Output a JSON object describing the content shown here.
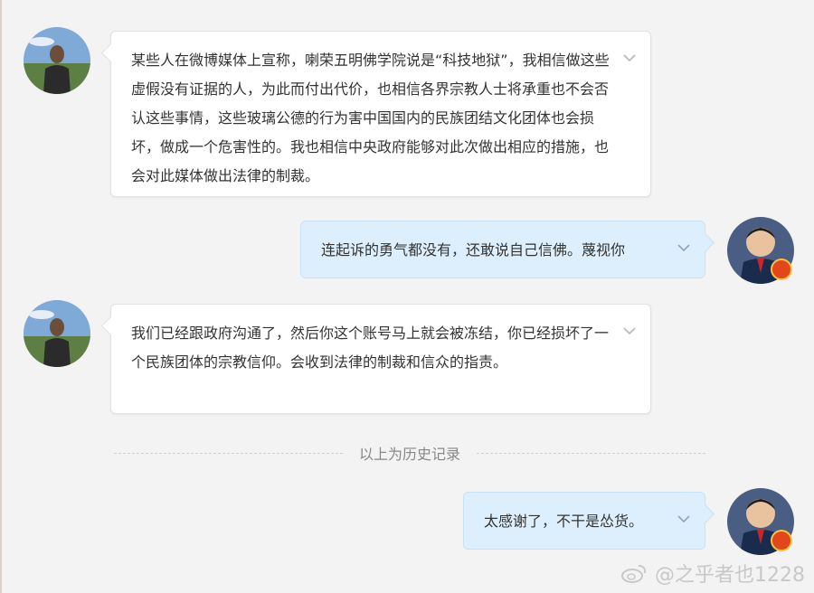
{
  "messages": [
    {
      "side": "in",
      "text": "某些人在微博媒体上宣称，喇荣五明佛学院说是“科技地狱”，我相信做这些虚假没有证据的人，为此而付出代价，也相信各界宗教人士将承重也不会否认这些事情，这些玻璃公德的行为害中国国内的民族团结文化团体也会损坏，做成一个危害性的。我也相信中央政府能够对此次做出相应的措施，也会对此媒体做出法律的制裁。"
    },
    {
      "side": "out",
      "text": "连起诉的勇气都没有，还敢说自己信佛。蔑视你"
    },
    {
      "side": "in",
      "text": "我们已经跟政府沟通了，然后你这个账号马上就会被冻结，你已经损坏了一个民族团体的宗教信仰。会收到法律的制裁和信众的指责。"
    },
    {
      "side": "out",
      "text": "太感谢了，不干是怂货。"
    }
  ],
  "history_divider": "以上为历史记录",
  "watermark": {
    "text": "@之乎者也1228"
  },
  "icons": {
    "message_menu": "chevron-down-icon",
    "watermark_logo": "weibo-logo-icon",
    "verified": "verified-badge-icon"
  },
  "colors": {
    "incoming_bubble": "#ffffff",
    "outgoing_bubble": "#ddeffc",
    "background": "#f3f3f3",
    "badge": "#e4461b"
  }
}
